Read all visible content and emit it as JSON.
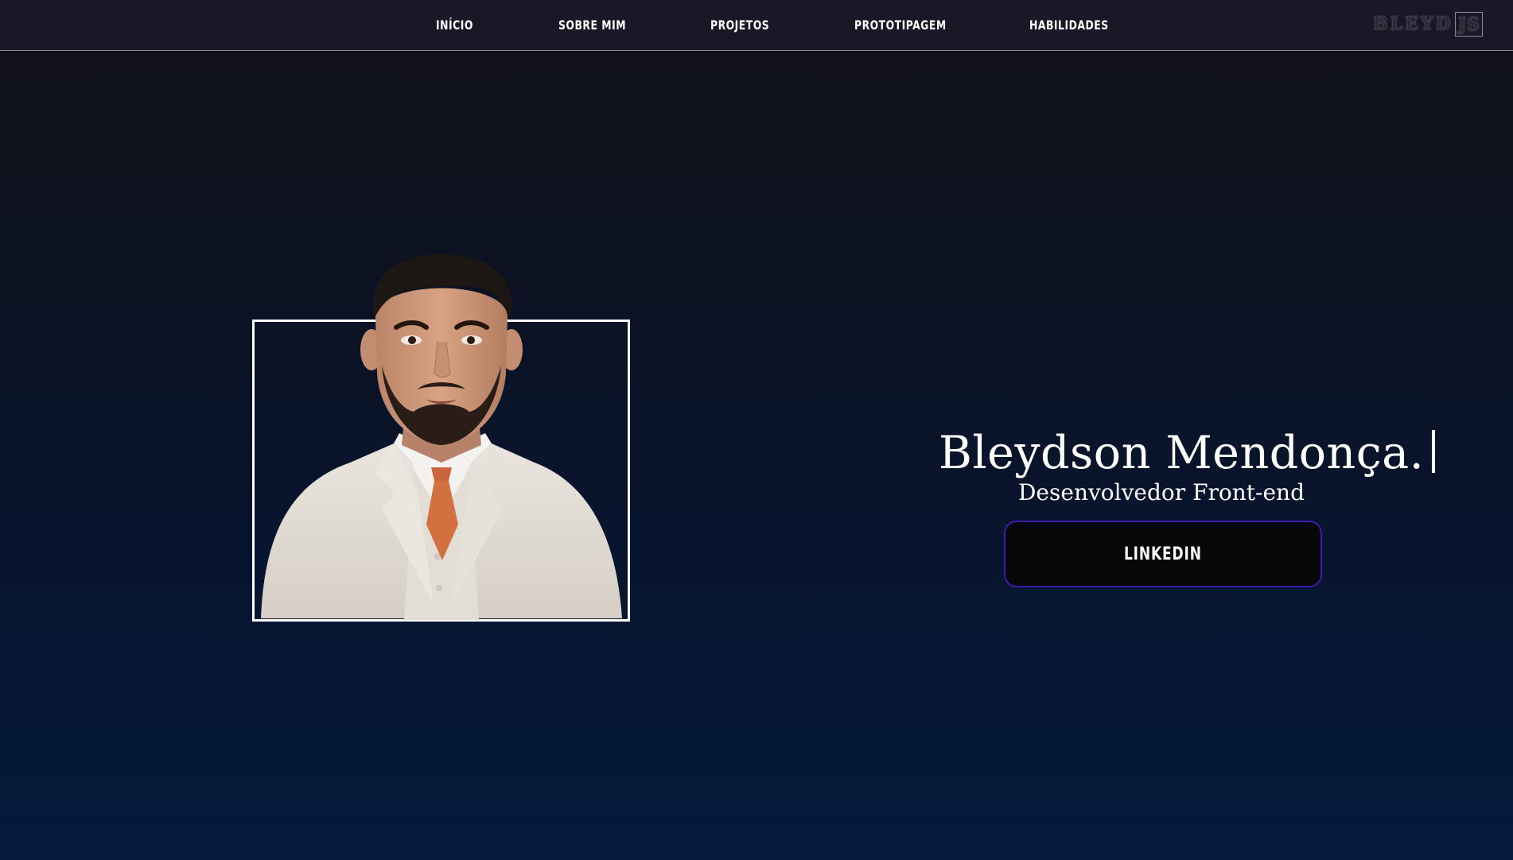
{
  "nav": {
    "items": [
      {
        "label": "INÍCIO"
      },
      {
        "label": "SOBRE MIM"
      },
      {
        "label": "PROJETOS"
      },
      {
        "label": "PROTOTIPAGEM"
      },
      {
        "label": "HABILIDADES"
      }
    ],
    "logo": {
      "text": "BLEYD",
      "boxed": "JS"
    }
  },
  "hero": {
    "name": "Bleydson Mendonça.",
    "role": "Desenvolvedor Front-end",
    "button_label": "LINKEDIN"
  },
  "portrait": {
    "icon": "person-portrait"
  },
  "colors": {
    "nav_background": "#1a1726",
    "page_gradient_top": "#111118",
    "page_gradient_bottom": "#041a3c",
    "button_border": "#3b1bb0",
    "button_background": "#080808",
    "text": "#ffffff"
  }
}
